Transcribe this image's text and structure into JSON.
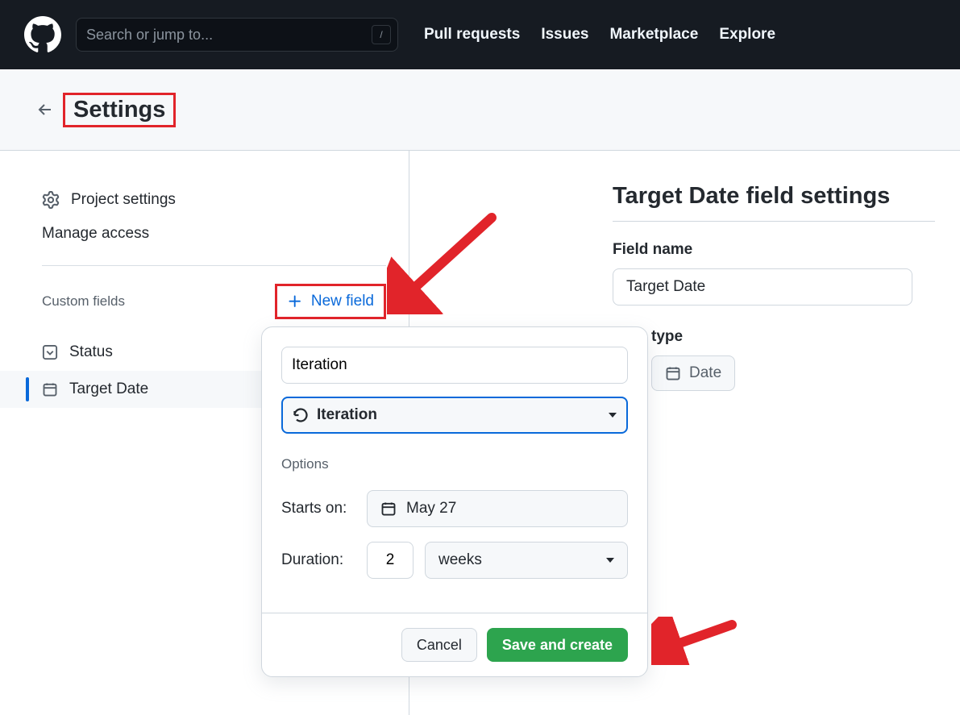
{
  "header": {
    "search_placeholder": "Search or jump to...",
    "search_kbd": "/",
    "nav": {
      "pull_requests": "Pull requests",
      "issues": "Issues",
      "marketplace": "Marketplace",
      "explore": "Explore"
    }
  },
  "subheader": {
    "title": "Settings"
  },
  "sidebar": {
    "project_settings": "Project settings",
    "manage_access": "Manage access",
    "custom_fields_label": "Custom fields",
    "new_field_label": "New field",
    "fields": [
      {
        "label": "Status"
      },
      {
        "label": "Target Date"
      }
    ]
  },
  "main": {
    "title": "Target Date field settings",
    "field_name_label": "Field name",
    "field_name_value": "Target Date",
    "field_type_label": "type",
    "field_type_value": "Date"
  },
  "popover": {
    "name_value": "Iteration",
    "type_value": "Iteration",
    "options_label": "Options",
    "starts_on_label": "Starts on:",
    "starts_on_value": "May 27",
    "duration_label": "Duration:",
    "duration_value": "2",
    "duration_unit": "weeks",
    "cancel_label": "Cancel",
    "save_label": "Save and create"
  }
}
